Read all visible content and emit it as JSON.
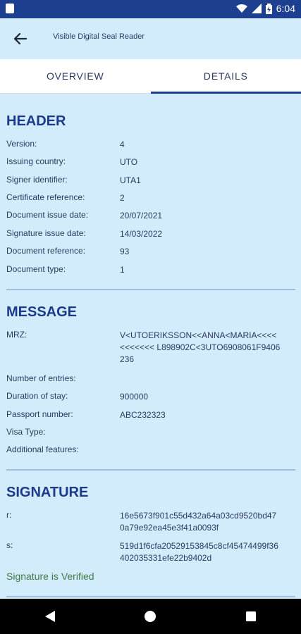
{
  "status_bar": {
    "time": "6:04"
  },
  "app_bar": {
    "title": "Visible Digital Seal Reader"
  },
  "tabs": [
    {
      "label": "OVERVIEW"
    },
    {
      "label": "DETAILS"
    }
  ],
  "header_section": {
    "title": "HEADER",
    "rows": [
      {
        "label": "Version:",
        "value": "4"
      },
      {
        "label": "Issuing country:",
        "value": "UTO"
      },
      {
        "label": "Signer identifier:",
        "value": "UTA1"
      },
      {
        "label": "Certificate reference:",
        "value": "2"
      },
      {
        "label": "Document issue date:",
        "value": "20/07/2021"
      },
      {
        "label": "Signature issue date:",
        "value": "14/03/2022"
      },
      {
        "label": "Document reference:",
        "value": "93"
      },
      {
        "label": "Document type:",
        "value": "1"
      }
    ]
  },
  "message_section": {
    "title": "MESSAGE",
    "rows": [
      {
        "label": "MRZ:",
        "value": "V<UTOERIKSSON<<ANNA<MARIA<<<<<<<<<<< L898902C<3UTO6908061F9406236"
      },
      {
        "label": "Number of entries:",
        "value": ""
      },
      {
        "label": "Duration of stay:",
        "value": "900000"
      },
      {
        "label": "Passport number:",
        "value": "ABC232323"
      },
      {
        "label": "Visa Type:",
        "value": ""
      },
      {
        "label": "Additional features:",
        "value": ""
      }
    ]
  },
  "signature_section": {
    "title": "SIGNATURE",
    "rows": [
      {
        "label": "r:",
        "value": "16e5673f901c55d432a64a03cd9520bd470a79e92ea45e3f41a0093f"
      },
      {
        "label": "s:",
        "value": "519d1f6cfa20529153845c8cf45474499f36402035331efe22b9402d"
      }
    ],
    "status": "Signature is Verified"
  }
}
